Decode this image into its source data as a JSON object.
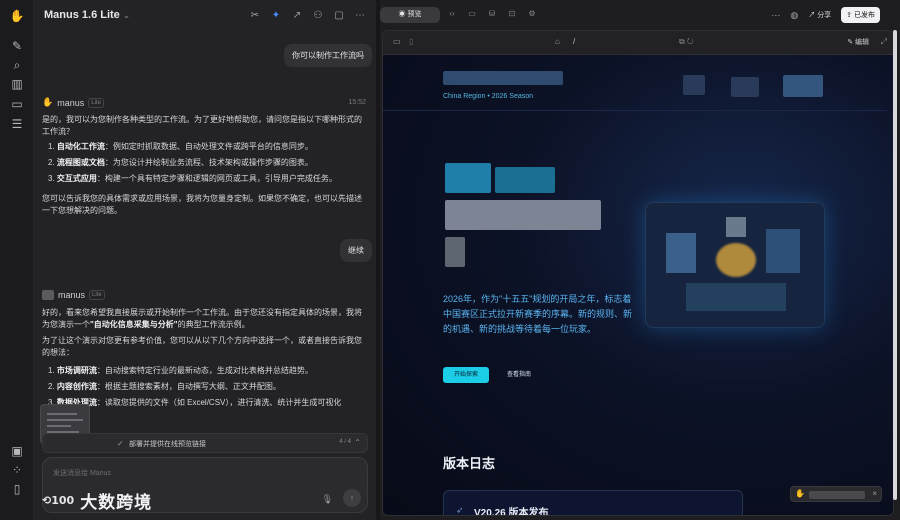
{
  "chat": {
    "title": "Manus 1.6 Lite",
    "user_msg_1": "你可以制作工作流吗",
    "agent_name": "manus",
    "agent_tag": "Lite",
    "time_1": "15:52",
    "reply_1_intro": "是的，我可以为您制作各种类型的工作流。为了更好地帮助您，请问您是指以下哪种形式的工作流？",
    "reply_1_items": [
      {
        "num": "1.",
        "title": "自动化工作流",
        "text": "：例如定时抓取数据、自动处理文件或跨平台的信息同步。"
      },
      {
        "num": "2.",
        "title": "流程图或文档",
        "text": "：为您设计并绘制业务流程、技术架构或操作步骤的图表。"
      },
      {
        "num": "3.",
        "title": "交互式应用",
        "text": "：构建一个具有特定步骤和逻辑的网页或工具，引导用户完成任务。"
      }
    ],
    "reply_1_outro": "您可以告诉我您的具体需求或应用场景，我将为您量身定制。如果您不确定，也可以先描述一下您想解决的问题。",
    "user_msg_2": "继续",
    "reply_2_p1": "好的，看来您希望我直接展示或开始制作一个工作流。由于您还没有指定具体的场景，我将为您演示一个",
    "reply_2_p1_bold": "\"自动化信息采集与分析\"",
    "reply_2_p1_end": "的典型工作流示例。",
    "reply_2_p2": "为了让这个演示对您更有参考价值，您可以从以下几个方向中选择一个，或者直接告诉我您的想法：",
    "reply_2_items": [
      {
        "num": "1.",
        "title": "市场调研流",
        "text": "：自动搜索特定行业的最新动态，生成对比表格并总结趋势。"
      },
      {
        "num": "2.",
        "title": "内容创作流",
        "text": "：根据主题搜索素材，自动撰写大纲、正文并配图。"
      },
      {
        "num": "3.",
        "title": "数据处理流",
        "text": "：读取您提供的文件（如 Excel/CSV），进行清洗、统计并生成可视化"
      }
    ],
    "task_text": "部署并提供在线预览链接",
    "task_count": "4 / 4",
    "composer_placeholder": "发送消息给 Manus",
    "watermark_text": "大数跨境"
  },
  "topbar": {
    "preview_label": "预览",
    "share_label": "分享",
    "publish_label": "已发布"
  },
  "browser": {
    "path": "/",
    "edit_label": "编辑"
  },
  "site": {
    "subbrand": "China Region • 2026 Season",
    "hero_paragraph": "2026年，作为\"十五五\"规划的开局之年，标志着中国赛区正式拉开新赛季的序幕。新的规则、新的机遇、新的挑战等待着每一位玩家。",
    "btn_primary": "开始探索",
    "btn_secondary": "查看指南",
    "changelog_title": "版本日志",
    "release_title": "V20.26 版本发布"
  },
  "colors": {
    "accent": "#4a8cff",
    "site_cyan": "#1ccde8",
    "site_text_blue": "#5ab4f0"
  }
}
